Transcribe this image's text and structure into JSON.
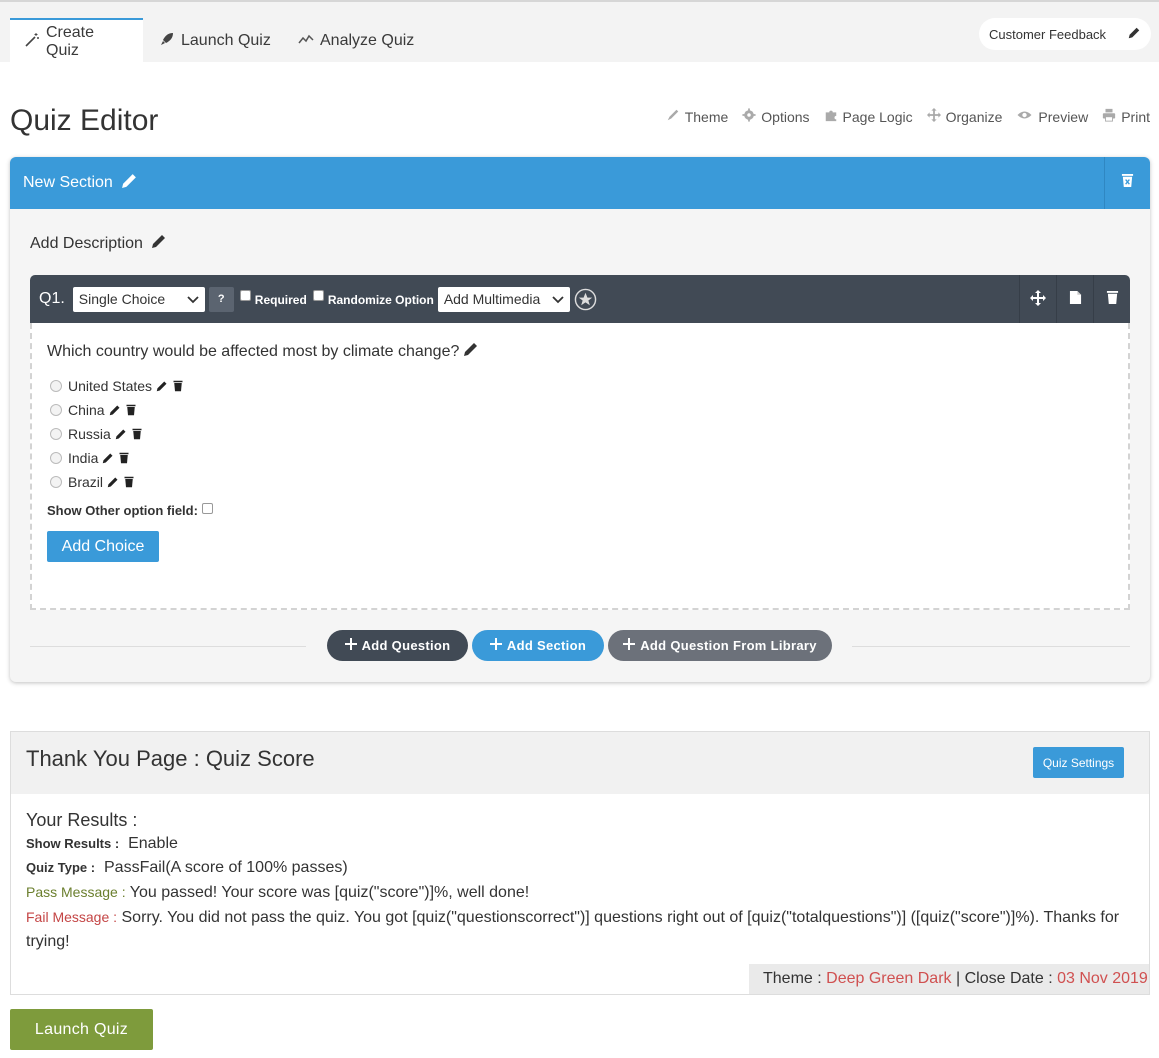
{
  "tabs": [
    {
      "label": "Create Quiz",
      "icon": "magic-wand-icon",
      "active": true
    },
    {
      "label": "Launch Quiz",
      "icon": "rocket-icon",
      "active": false
    },
    {
      "label": "Analyze Quiz",
      "icon": "line-chart-icon",
      "active": false
    }
  ],
  "feedback": {
    "label": "Customer Feedback",
    "icon": "pencil-icon"
  },
  "page_title": "Quiz Editor",
  "toolbar": [
    {
      "label": "Theme",
      "icon": "brush-icon"
    },
    {
      "label": "Options",
      "icon": "gear-icon"
    },
    {
      "label": "Page Logic",
      "icon": "puzzle-icon"
    },
    {
      "label": "Organize",
      "icon": "move-icon"
    },
    {
      "label": "Preview",
      "icon": "eye-icon"
    },
    {
      "label": "Print",
      "icon": "printer-icon"
    }
  ],
  "section": {
    "title": "New Section",
    "description": "Add Description",
    "question": {
      "number": "Q1.",
      "type": "Single Choice",
      "help": "?",
      "required_label": "Required",
      "randomize_label": "Randomize Option",
      "multimedia": "Add Multimedia",
      "text": "Which country would be affected most by climate change?",
      "choices": [
        "United States",
        "China",
        "Russia",
        "India",
        "Brazil"
      ],
      "show_other_label": "Show Other option field:",
      "add_choice_label": "Add Choice"
    },
    "buttons": {
      "add_question": "Add Question",
      "add_section": "Add Section",
      "add_from_library": "Add Question From Library"
    }
  },
  "thank_you": {
    "title": "Thank You Page : Quiz Score",
    "settings_button": "Quiz Settings",
    "results_heading": "Your Results :",
    "show_results_label": "Show Results :",
    "show_results_value": "Enable",
    "quiz_type_label": "Quiz Type :",
    "quiz_type_value": "PassFail(A score of 100% passes)",
    "pass_label": "Pass Message :",
    "pass_value": "You passed! Your score was [quiz(\"score\")]%, well done!",
    "fail_label": "Fail Message :",
    "fail_value": "Sorry. You did not pass the quiz. You got [quiz(\"questionscorrect\")] questions right out of [quiz(\"totalquestions\")] ([quiz(\"score\")]%). Thanks for trying!",
    "theme_label": "Theme :",
    "theme_value": "Deep Green Dark",
    "separator": "|",
    "close_label": "Close Date :",
    "close_value": "03 Nov 2019"
  },
  "launch_button": "Launch Quiz",
  "colors": {
    "primary": "#3a9ad9",
    "dark": "#414a55",
    "green": "#7e9b3c",
    "red": "#d05050"
  }
}
